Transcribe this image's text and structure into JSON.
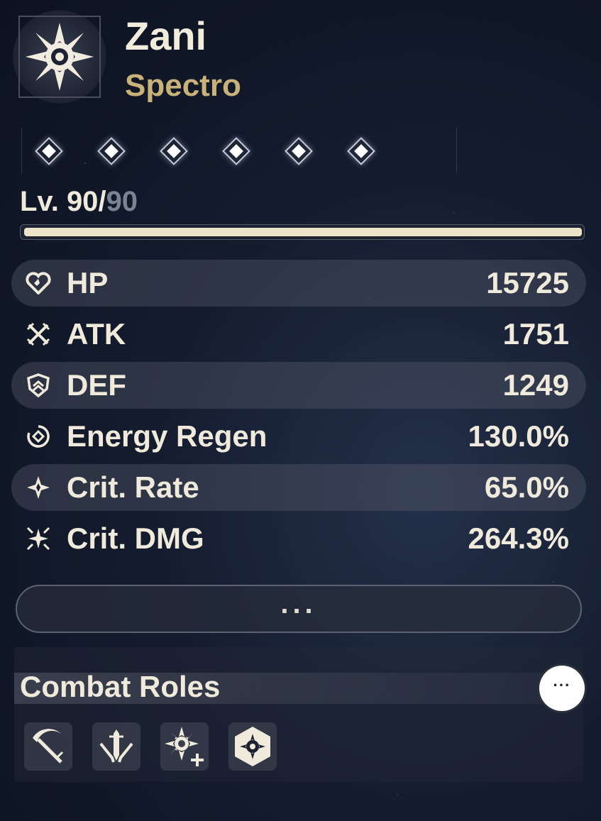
{
  "character": {
    "name": "Zani",
    "element": "Spectro"
  },
  "sequence": {
    "nodes": 6
  },
  "level": {
    "current": "90",
    "separator": "/",
    "max": "90",
    "prefix": "Lv. ",
    "progress": 1.0
  },
  "stats": [
    {
      "label": "HP",
      "value": "15725",
      "icon": "heart-icon"
    },
    {
      "label": "ATK",
      "value": "1751",
      "icon": "crossed-swords-icon"
    },
    {
      "label": "DEF",
      "value": "1249",
      "icon": "shield-icon"
    },
    {
      "label": "Energy Regen",
      "value": "130.0%",
      "icon": "energy-regen-icon"
    },
    {
      "label": "Crit. Rate",
      "value": "65.0%",
      "icon": "crit-rate-star-icon"
    },
    {
      "label": "Crit. DMG",
      "value": "264.3%",
      "icon": "crit-dmg-star-icon"
    }
  ],
  "more_button": {
    "label": "..."
  },
  "combat_roles": {
    "title": "Combat Roles",
    "more_label": "···",
    "roles": [
      "scythe-role-icon",
      "sword-role-icon",
      "spectro-plus-role-icon",
      "spectro-hex-role-icon"
    ]
  },
  "colors": {
    "element": "#c9b27a",
    "text": "#efeadb",
    "level_fill": "#ece3c8"
  }
}
